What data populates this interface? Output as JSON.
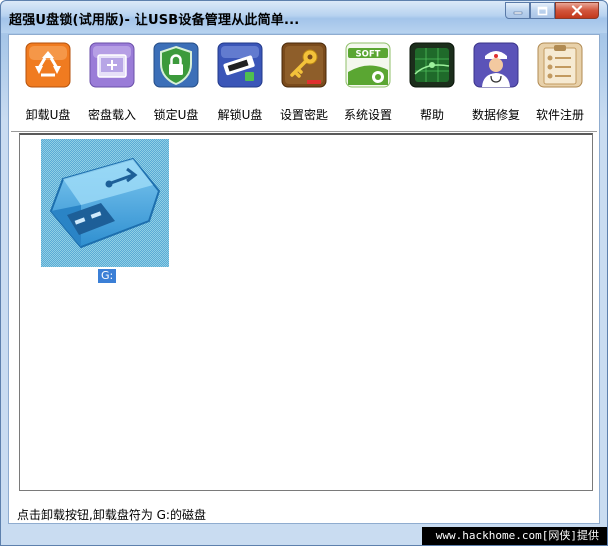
{
  "window": {
    "title": "超强U盘锁(试用版)- 让USB设备管理从此简单..."
  },
  "toolbar": {
    "items": [
      {
        "label": "卸载U盘",
        "icon": "recycle-icon",
        "color": "#f07b20"
      },
      {
        "label": "密盘载入",
        "icon": "disk-load-icon",
        "color": "#9a7cd8"
      },
      {
        "label": "锁定U盘",
        "icon": "shield-lock-icon",
        "color": "#3c8a3c"
      },
      {
        "label": "解锁U盘",
        "icon": "usb-unlock-icon",
        "color": "#3b56b8"
      },
      {
        "label": "设置密匙",
        "icon": "key-icon",
        "color": "#7a4b1c"
      },
      {
        "label": "系统设置",
        "icon": "soft-gear-icon",
        "color": "#5aa632"
      },
      {
        "label": "帮助",
        "icon": "radar-help-icon",
        "color": "#1f6a2a"
      },
      {
        "label": "数据修复",
        "icon": "doctor-icon",
        "color": "#5b53b8"
      },
      {
        "label": "软件注册",
        "icon": "clipboard-icon",
        "color": "#d9b27c"
      }
    ]
  },
  "drives": [
    {
      "label": "G:",
      "icon": "usb-drive-icon"
    }
  ],
  "status": {
    "text": "点击卸载按钮,卸载盘符为 G:的磁盘"
  },
  "watermark": {
    "text": "www.hackhome.com[网侠]提供"
  }
}
